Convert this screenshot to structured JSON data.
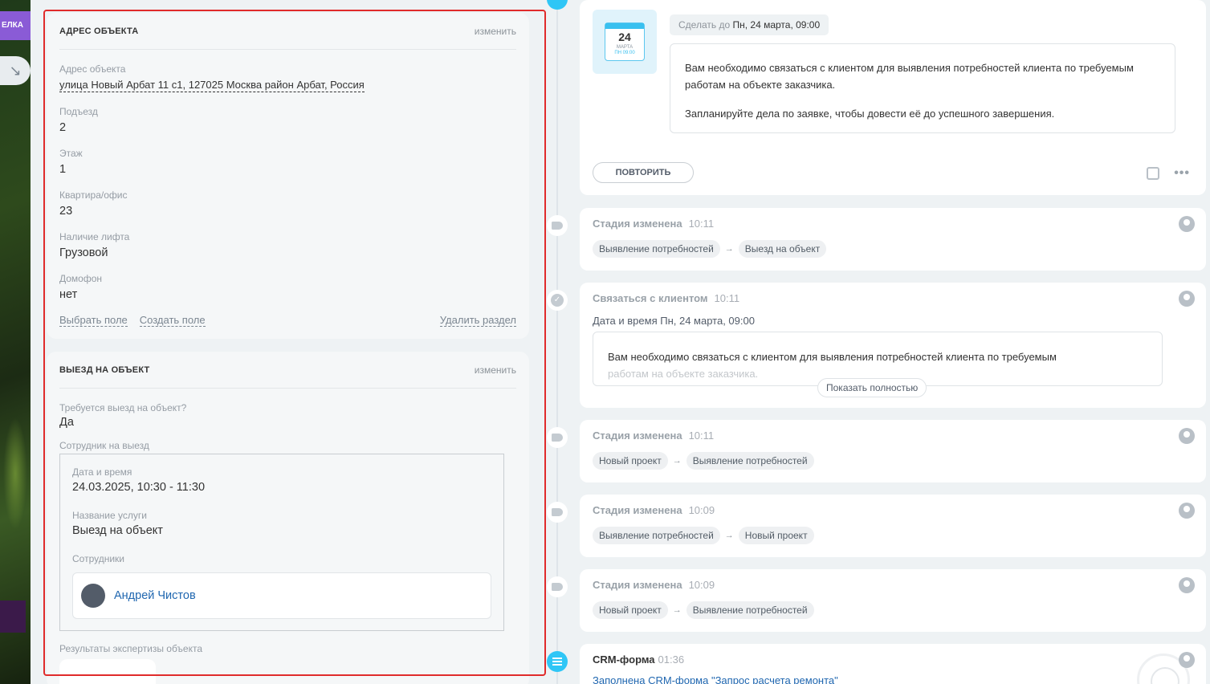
{
  "left_strip": {
    "tab_label": "ЕЛКА"
  },
  "address_section": {
    "title": "АДРЕС ОБЪЕКТА",
    "edit_label": "изменить",
    "fields": [
      {
        "label": "Адрес объекта",
        "value": "улица Новый Арбат 11 с1, 127025 Москва район Арбат, Россия"
      },
      {
        "label": "Подъезд",
        "value": "2"
      },
      {
        "label": "Этаж",
        "value": "1"
      },
      {
        "label": "Квартира/офис",
        "value": "23"
      },
      {
        "label": "Наличие лифта",
        "value": "Грузовой"
      },
      {
        "label": "Домофон",
        "value": "нет"
      }
    ],
    "select_field": "Выбрать поле",
    "create_field": "Создать поле",
    "delete_section": "Удалить раздел"
  },
  "visit_section": {
    "title": "ВЫЕЗД НА ОБЪЕКТ",
    "edit_label": "изменить",
    "required_label": "Требуется выезд на объект?",
    "required_value": "Да",
    "employee_label": "Сотрудник на выезд",
    "booking": {
      "datetime_label": "Дата и время",
      "datetime_value": "24.03.2025, 10:30 - 11:30",
      "service_label": "Название услуги",
      "service_value": "Выезд на объект",
      "staff_label": "Сотрудники",
      "staff_name": "Андрей Чистов"
    },
    "results_label": "Результаты экспертизы объекта"
  },
  "timeline": {
    "task": {
      "cal_day": "24",
      "cal_month": "МАРТА",
      "cal_weekday": "ПН 09:00",
      "deadline_prefix": "Сделать до",
      "deadline_value": "Пн, 24 марта, 09:00",
      "text_1": "Вам необходимо связаться с клиентом для выявления потребностей клиента по требуемым работам на объекте заказчика.",
      "text_2": "Запланируйте дела по заявке, чтобы довести её до успешного завершения.",
      "repeat_label": "ПОВТОРИТЬ",
      "more_label": "•••"
    },
    "stage_1": {
      "title": "Стадия изменена",
      "time": "10:11",
      "from": "Выявление потребностей",
      "to": "Выезд на объект"
    },
    "call": {
      "title": "Связаться с клиентом",
      "time": "10:11",
      "sub": "Дата и время Пн, 24 марта, 09:00",
      "text_line_1": "Вам необходимо связаться с клиентом для выявления потребностей клиента по требуемым",
      "text_line_2": "работам на объекте заказчика.",
      "show_full": "Показать полностью"
    },
    "stage_2": {
      "title": "Стадия изменена",
      "time": "10:11",
      "from": "Новый проект",
      "to": "Выявление потребностей"
    },
    "stage_3": {
      "title": "Стадия изменена",
      "time": "10:09",
      "from": "Выявление потребностей",
      "to": "Новый проект"
    },
    "stage_4": {
      "title": "Стадия изменена",
      "time": "10:09",
      "from": "Новый проект",
      "to": "Выявление потребностей"
    },
    "crm": {
      "title": "CRM-форма",
      "time": "01:36",
      "link": "Заполнена CRM-форма \"Запрос расчета ремонта\""
    },
    "arrow": "→"
  }
}
